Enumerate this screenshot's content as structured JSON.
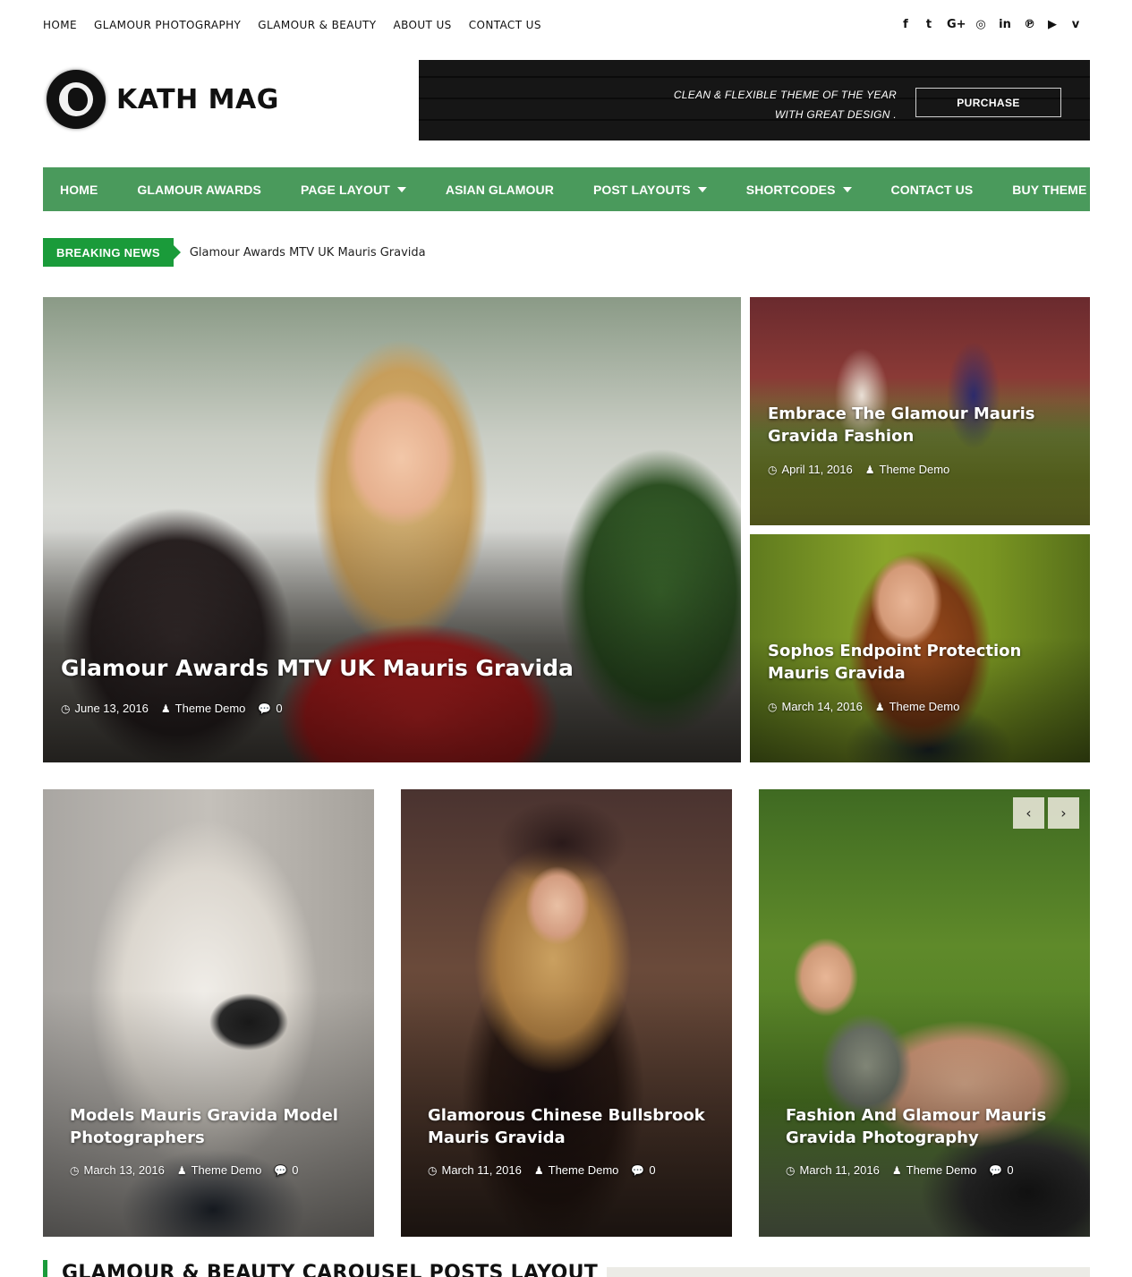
{
  "top_nav": [
    "HOME",
    "GLAMOUR PHOTOGRAPHY",
    "GLAMOUR & BEAUTY",
    "ABOUT US",
    "CONTACT US"
  ],
  "social_icons": [
    {
      "name": "facebook-icon",
      "glyph": "f"
    },
    {
      "name": "twitter-icon",
      "glyph": "t"
    },
    {
      "name": "google-plus-icon",
      "glyph": "G+"
    },
    {
      "name": "instagram-icon",
      "glyph": "◎"
    },
    {
      "name": "linkedin-icon",
      "glyph": "in"
    },
    {
      "name": "pinterest-icon",
      "glyph": "℗"
    },
    {
      "name": "youtube-icon",
      "glyph": "▶"
    },
    {
      "name": "vimeo-icon",
      "glyph": "v"
    }
  ],
  "logo": {
    "text": "KATH MAG"
  },
  "banner": {
    "line1": "CLEAN & FLEXIBLE THEME OF THE YEAR",
    "line2": "WITH GREAT DESIGN .",
    "button": "PURCHASE"
  },
  "main_nav": [
    {
      "label": "HOME",
      "dropdown": false
    },
    {
      "label": "GLAMOUR AWARDS",
      "dropdown": false
    },
    {
      "label": "PAGE LAYOUT",
      "dropdown": true
    },
    {
      "label": "ASIAN GLAMOUR",
      "dropdown": false
    },
    {
      "label": "POST LAYOUTS",
      "dropdown": true
    },
    {
      "label": "SHORTCODES",
      "dropdown": true
    },
    {
      "label": "CONTACT US",
      "dropdown": false
    },
    {
      "label": "BUY THEME",
      "dropdown": false
    }
  ],
  "breaking": {
    "label": "BREAKING NEWS",
    "text": "Glamour Awards MTV UK Mauris Gravida"
  },
  "posts": {
    "main": {
      "title": "Glamour Awards MTV UK Mauris Gravida",
      "date": "June 13, 2016",
      "author": "Theme Demo",
      "comments": "0"
    },
    "top": {
      "title": "Embrace The Glamour Mauris Gravida Fashion",
      "date": "April 11, 2016",
      "author": "Theme Demo"
    },
    "mid": {
      "title": "Sophos Endpoint Protection Mauris Gravida",
      "date": "March 14, 2016",
      "author": "Theme Demo"
    },
    "b1": {
      "title": "Models Mauris Gravida Model Photographers",
      "date": "March 13, 2016",
      "author": "Theme Demo",
      "comments": "0"
    },
    "b2": {
      "title": "Glamorous Chinese Bullsbrook Mauris Gravida",
      "date": "March 11, 2016",
      "author": "Theme Demo",
      "comments": "0"
    },
    "b3": {
      "title": "Fashion And Glamour Mauris Gravida Photography",
      "date": "March 11, 2016",
      "author": "Theme Demo",
      "comments": "0"
    }
  },
  "slider": {
    "prev": "‹",
    "next": "›"
  },
  "section": {
    "title": "GLAMOUR & BEAUTY CAROUSEL POSTS LAYOUT"
  },
  "colors": {
    "nav_green": "#4a9a5c",
    "breaking_green": "#1a9b3a"
  }
}
